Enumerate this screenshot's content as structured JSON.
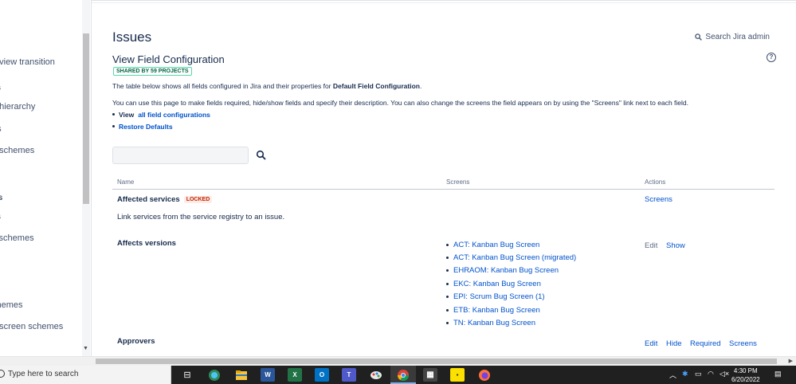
{
  "sidebar": {
    "items": [
      {
        "label": "e view transition",
        "kind": "item"
      },
      {
        "label": "es",
        "kind": "heading"
      },
      {
        "label": "e hierarchy",
        "kind": "item"
      },
      {
        "label": "es",
        "kind": "item"
      },
      {
        "label": "e schemes",
        "kind": "item"
      },
      {
        "label": "s",
        "kind": "item"
      },
      {
        "label": "ws",
        "kind": "heading"
      },
      {
        "label": "vs",
        "kind": "item"
      },
      {
        "label": "v schemes",
        "kind": "item"
      },
      {
        "label": "chemes",
        "kind": "item"
      },
      {
        "label": "e screen schemes",
        "kind": "item"
      }
    ]
  },
  "header": {
    "title": "Issues",
    "search_label": "Search Jira admin"
  },
  "config": {
    "title": "View Field Configuration",
    "shared_badge": "SHARED BY 59 PROJECTS",
    "desc_prefix": "The table below shows all fields configured in Jira and their properties for ",
    "desc_bold": "Default Field Configuration",
    "desc_suffix": ".",
    "desc2": "You can use this page to make fields required, hide/show fields and specify their description. You can also change the screens the field appears on by using the \"Screens\" link next to each field.",
    "links": [
      {
        "prefix": "View",
        "label": "all field configurations"
      },
      {
        "prefix": "",
        "label": "Restore Defaults"
      }
    ],
    "help_label": "?"
  },
  "table": {
    "headers": {
      "name": "Name",
      "screens": "Screens",
      "actions": "Actions"
    },
    "rows": [
      {
        "name": "Affected services",
        "badge": "LOCKED",
        "description": "Link services from the service registry to an issue.",
        "actions": [
          "Screens"
        ]
      },
      {
        "name": "Affects versions",
        "screens": [
          "ACT: Kanban Bug Screen",
          "ACT: Kanban Bug Screen (migrated)",
          "EHRAOM: Kanban Bug Screen",
          "EKC: Kanban Bug Screen",
          "EPI: Scrum Bug Screen (1)",
          "ETB: Kanban Bug Screen",
          "TN: Kanban Bug Screen"
        ],
        "actions": [
          "Edit",
          "Show"
        ]
      },
      {
        "name": "Approvers",
        "actions": [
          "Edit",
          "Hide",
          "Required",
          "Screens"
        ]
      }
    ]
  },
  "taskbar": {
    "search_placeholder": "Type here to search",
    "time": "4:30 PM",
    "date": "6/20/2022",
    "apps": [
      "task-view",
      "edge",
      "file-explorer",
      "word",
      "excel",
      "outlook",
      "teams",
      "paint",
      "chrome",
      "calculator",
      "sticky-notes",
      "firefox"
    ]
  },
  "colors": {
    "link": "#0052cc",
    "text": "#172b4d",
    "locked_bg": "#ffebe6",
    "locked_text": "#bf2600",
    "shared_border": "#57d9a3"
  }
}
